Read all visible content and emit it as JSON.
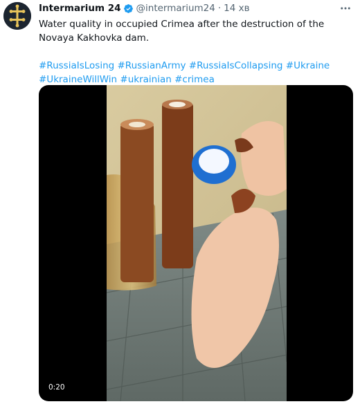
{
  "author": {
    "display_name": "Intermarium 24",
    "handle": "@intermarium24",
    "separator": "·",
    "time": "14 хв",
    "avatar_icon": "double-cross-emblem",
    "verified_icon": "verified-badge-icon"
  },
  "tweet": {
    "text": "Water quality in occupied Crimea after the destruction of the Novaya Kakhovka dam.",
    "hashtags_line1": [
      "#RussiaIsLosing",
      "#RussianArmy",
      "#RussiaIsCollapsing",
      "#Ukraine"
    ],
    "hashtags_line2": [
      "#UkraineWillWin",
      "#ukrainian",
      "#crimea"
    ]
  },
  "media": {
    "type": "video",
    "timestamp": "0:20"
  },
  "colors": {
    "accent": "#1d9bf0",
    "text": "#0f1419",
    "secondary": "#536471",
    "avatar_bg": "#1c2530",
    "emblem": "#e8c45a"
  },
  "icons": {
    "more": "more-horizontal-icon"
  }
}
